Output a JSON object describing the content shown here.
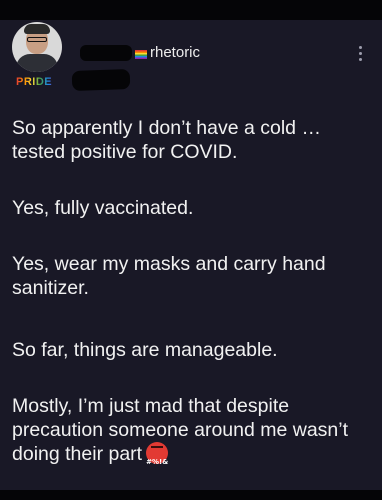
{
  "post": {
    "handle": "rhetoric",
    "shirt_text": "PRIDE",
    "paragraphs": [
      "So apparently I don’t have a cold … tested positive for COVID.",
      "Yes, fully vaccinated.",
      "Yes, wear my masks and carry hand sanitizer.",
      "So far, things are manageable.",
      "Mostly, I’m just mad that despite precaution someone around me wasn’t doing their part"
    ],
    "emoji_text": "#%!&",
    "emoji_name": "swearing-face-icon"
  },
  "colors": {
    "background": "#191826",
    "frame": "#050507",
    "text": "#f1f1f1",
    "emoji": "#e23a33"
  }
}
